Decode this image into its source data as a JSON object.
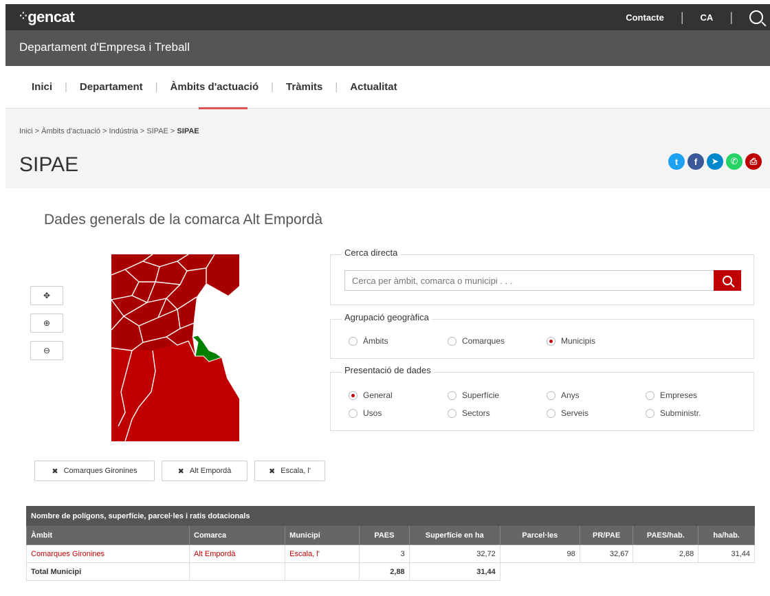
{
  "brand": {
    "logo_text": "gencat"
  },
  "top": {
    "contact": "Contacte",
    "lang": "CA"
  },
  "dept": {
    "name": "Departament d'Empresa i Treball"
  },
  "nav": {
    "items": [
      "Inici",
      "Departament",
      "Àmbits d'actuació",
      "Tràmits",
      "Actualitat"
    ],
    "active": "Àmbits d'actuació"
  },
  "breadcrumb": {
    "items": [
      "Inici",
      "Àmbits d'actuació",
      "Indústria",
      "SIPAE"
    ],
    "current": "SIPAE"
  },
  "page": {
    "title": "SIPAE",
    "subtitle": "Dades generals de la comarca Alt Empordà"
  },
  "share": [
    {
      "icon": "twitter-icon",
      "glyph": "t",
      "color": "#1da1f2"
    },
    {
      "icon": "facebook-icon",
      "glyph": "f",
      "color": "#3b5998"
    },
    {
      "icon": "telegram-icon",
      "glyph": "➤",
      "color": "#0088cc"
    },
    {
      "icon": "whatsapp-icon",
      "glyph": "✆",
      "color": "#25d366"
    },
    {
      "icon": "print-icon",
      "glyph": "⎙",
      "color": "#c00000"
    }
  ],
  "map_controls": {
    "center": "✥",
    "zoom_in": "⊕",
    "zoom_out": "⊖"
  },
  "search": {
    "legend": "Cerca directa",
    "placeholder": "Cerca per àmbit, comarca o municipi . . ."
  },
  "geo": {
    "legend": "Agrupació geogràfica",
    "options": [
      "Àmbits",
      "Comarques",
      "Municipis"
    ],
    "selected": "Municipis"
  },
  "presentation": {
    "legend": "Presentació de dades",
    "options": [
      "General",
      "Superfície",
      "Anys",
      "Empreses",
      "Usos",
      "Sectors",
      "Serveis",
      "Subministr."
    ],
    "selected": "General"
  },
  "filters": [
    "Comarques Gironines",
    "Alt Empordà",
    "Escala, l'"
  ],
  "table": {
    "title": "Nombre de polígons, superfície, parcel·les i ratis dotacionals",
    "headers": [
      "Àmbit",
      "Comarca",
      "Municipi",
      "PAES",
      "Superfície en ha",
      "Parcel·les",
      "PR/PAE",
      "PAES/hab.",
      "ha/hab."
    ],
    "rows": [
      [
        "Comarques Gironines",
        "Alt Empordà",
        "Escala, l'",
        "3",
        "32,72",
        "98",
        "32,67",
        "2,88",
        "31,44"
      ]
    ],
    "total": [
      "Total Municipi",
      "",
      "",
      "2,88",
      "31,44"
    ]
  },
  "colors": {
    "accent": "#c00000",
    "map_fill": "#c00000",
    "map_dark": "#a80000",
    "selected_region": "#008000"
  }
}
